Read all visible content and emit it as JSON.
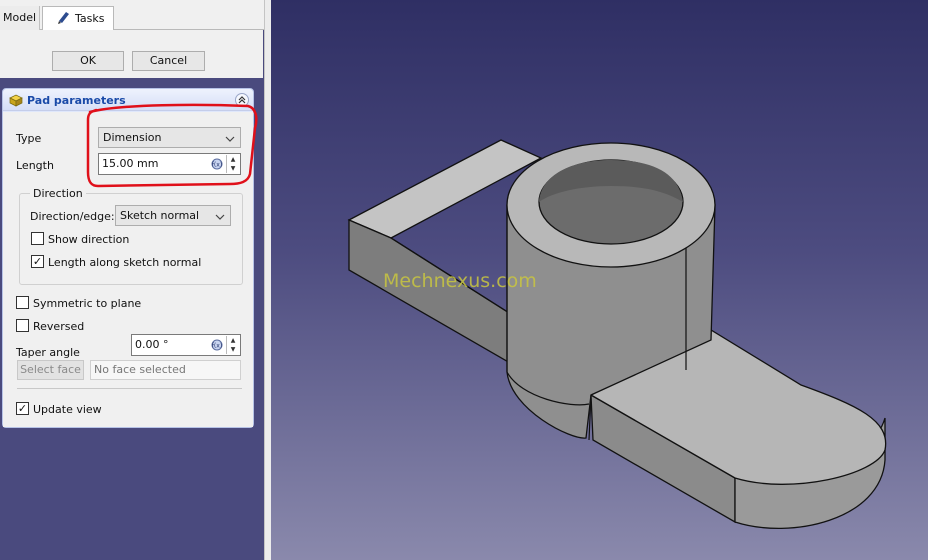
{
  "tabs": [
    {
      "label": "Model"
    },
    {
      "label": "Tasks"
    }
  ],
  "dialog": {
    "ok_label": "OK",
    "cancel_label": "Cancel"
  },
  "pad_parameters": {
    "title": "Pad parameters",
    "type_label": "Type",
    "type_value": "Dimension",
    "length_label": "Length",
    "length_value": "15.00 mm",
    "direction": {
      "group_label": "Direction",
      "edge_label": "Direction/edge:",
      "edge_value": "Sketch normal",
      "show_direction_label": "Show direction",
      "show_direction_checked": false,
      "along_normal_label": "Length along sketch normal",
      "along_normal_checked": true
    },
    "symmetric_label": "Symmetric to plane",
    "symmetric_checked": false,
    "reversed_label": "Reversed",
    "reversed_checked": false,
    "taper_label": "Taper angle",
    "taper_value": "0.00 °",
    "select_face_label": "Select face",
    "face_placeholder": "No face selected",
    "update_view_label": "Update view",
    "update_view_checked": true
  },
  "viewport": {
    "watermark": "Mechnexus.com"
  },
  "colors": {
    "annotation": "#e0101a",
    "panel_header": "#1a4aa8",
    "watermark": "#c9c640"
  }
}
